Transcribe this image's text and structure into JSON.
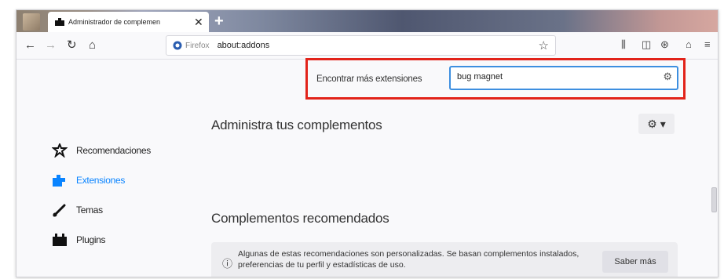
{
  "tab": {
    "title": "Administrador de complemen",
    "close": "✕",
    "new": "+"
  },
  "urlbar": {
    "identity": "Firefox",
    "url": "about:addons"
  },
  "search": {
    "label": "Encontrar más extensiones",
    "value": "bug magnet"
  },
  "sidebar": {
    "items": [
      {
        "label": "Recomendaciones",
        "icon": "recommendations-icon"
      },
      {
        "label": "Extensiones",
        "icon": "extensions-icon",
        "active": true
      },
      {
        "label": "Temas",
        "icon": "themes-icon"
      },
      {
        "label": "Plugins",
        "icon": "plugins-icon"
      }
    ]
  },
  "main": {
    "heading": "Administra tus complementos",
    "gear_label": "⚙ ▾",
    "recommended_heading": "Complementos recomendados",
    "notice": {
      "text": "Algunas de estas recomendaciones son personalizadas. Se basan complementos instalados, preferencias de tu perfil y estadísticas de uso.",
      "button": "Saber más"
    }
  },
  "colors": {
    "accent": "#0a84ff",
    "highlight": "#e2231a",
    "focus": "#3d8fe0"
  }
}
